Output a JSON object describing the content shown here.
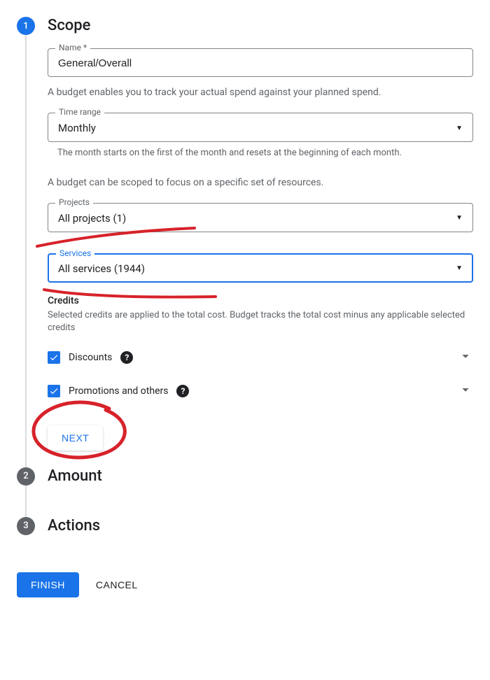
{
  "steps": {
    "scope": {
      "num": "1",
      "title": "Scope"
    },
    "amount": {
      "num": "2",
      "title": "Amount"
    },
    "actions": {
      "num": "3",
      "title": "Actions"
    }
  },
  "name": {
    "label": "Name *",
    "value": "General/Overall"
  },
  "desc1": "A budget enables you to track your actual spend against your planned spend.",
  "time_range": {
    "label": "Time range",
    "value": "Monthly",
    "helper": "The month starts on the first of the month and resets at the beginning of each month."
  },
  "desc2": "A budget can be scoped to focus on a specific set of resources.",
  "projects": {
    "label": "Projects",
    "value": "All projects (1)"
  },
  "services": {
    "label": "Services",
    "value": "All services (1944)"
  },
  "credits": {
    "heading": "Credits",
    "sub": "Selected credits are applied to the total cost. Budget tracks the total cost minus any applicable selected credits",
    "items": [
      {
        "label": "Discounts"
      },
      {
        "label": "Promotions and others"
      }
    ]
  },
  "buttons": {
    "next": "NEXT",
    "finish": "FINISH",
    "cancel": "CANCEL"
  }
}
